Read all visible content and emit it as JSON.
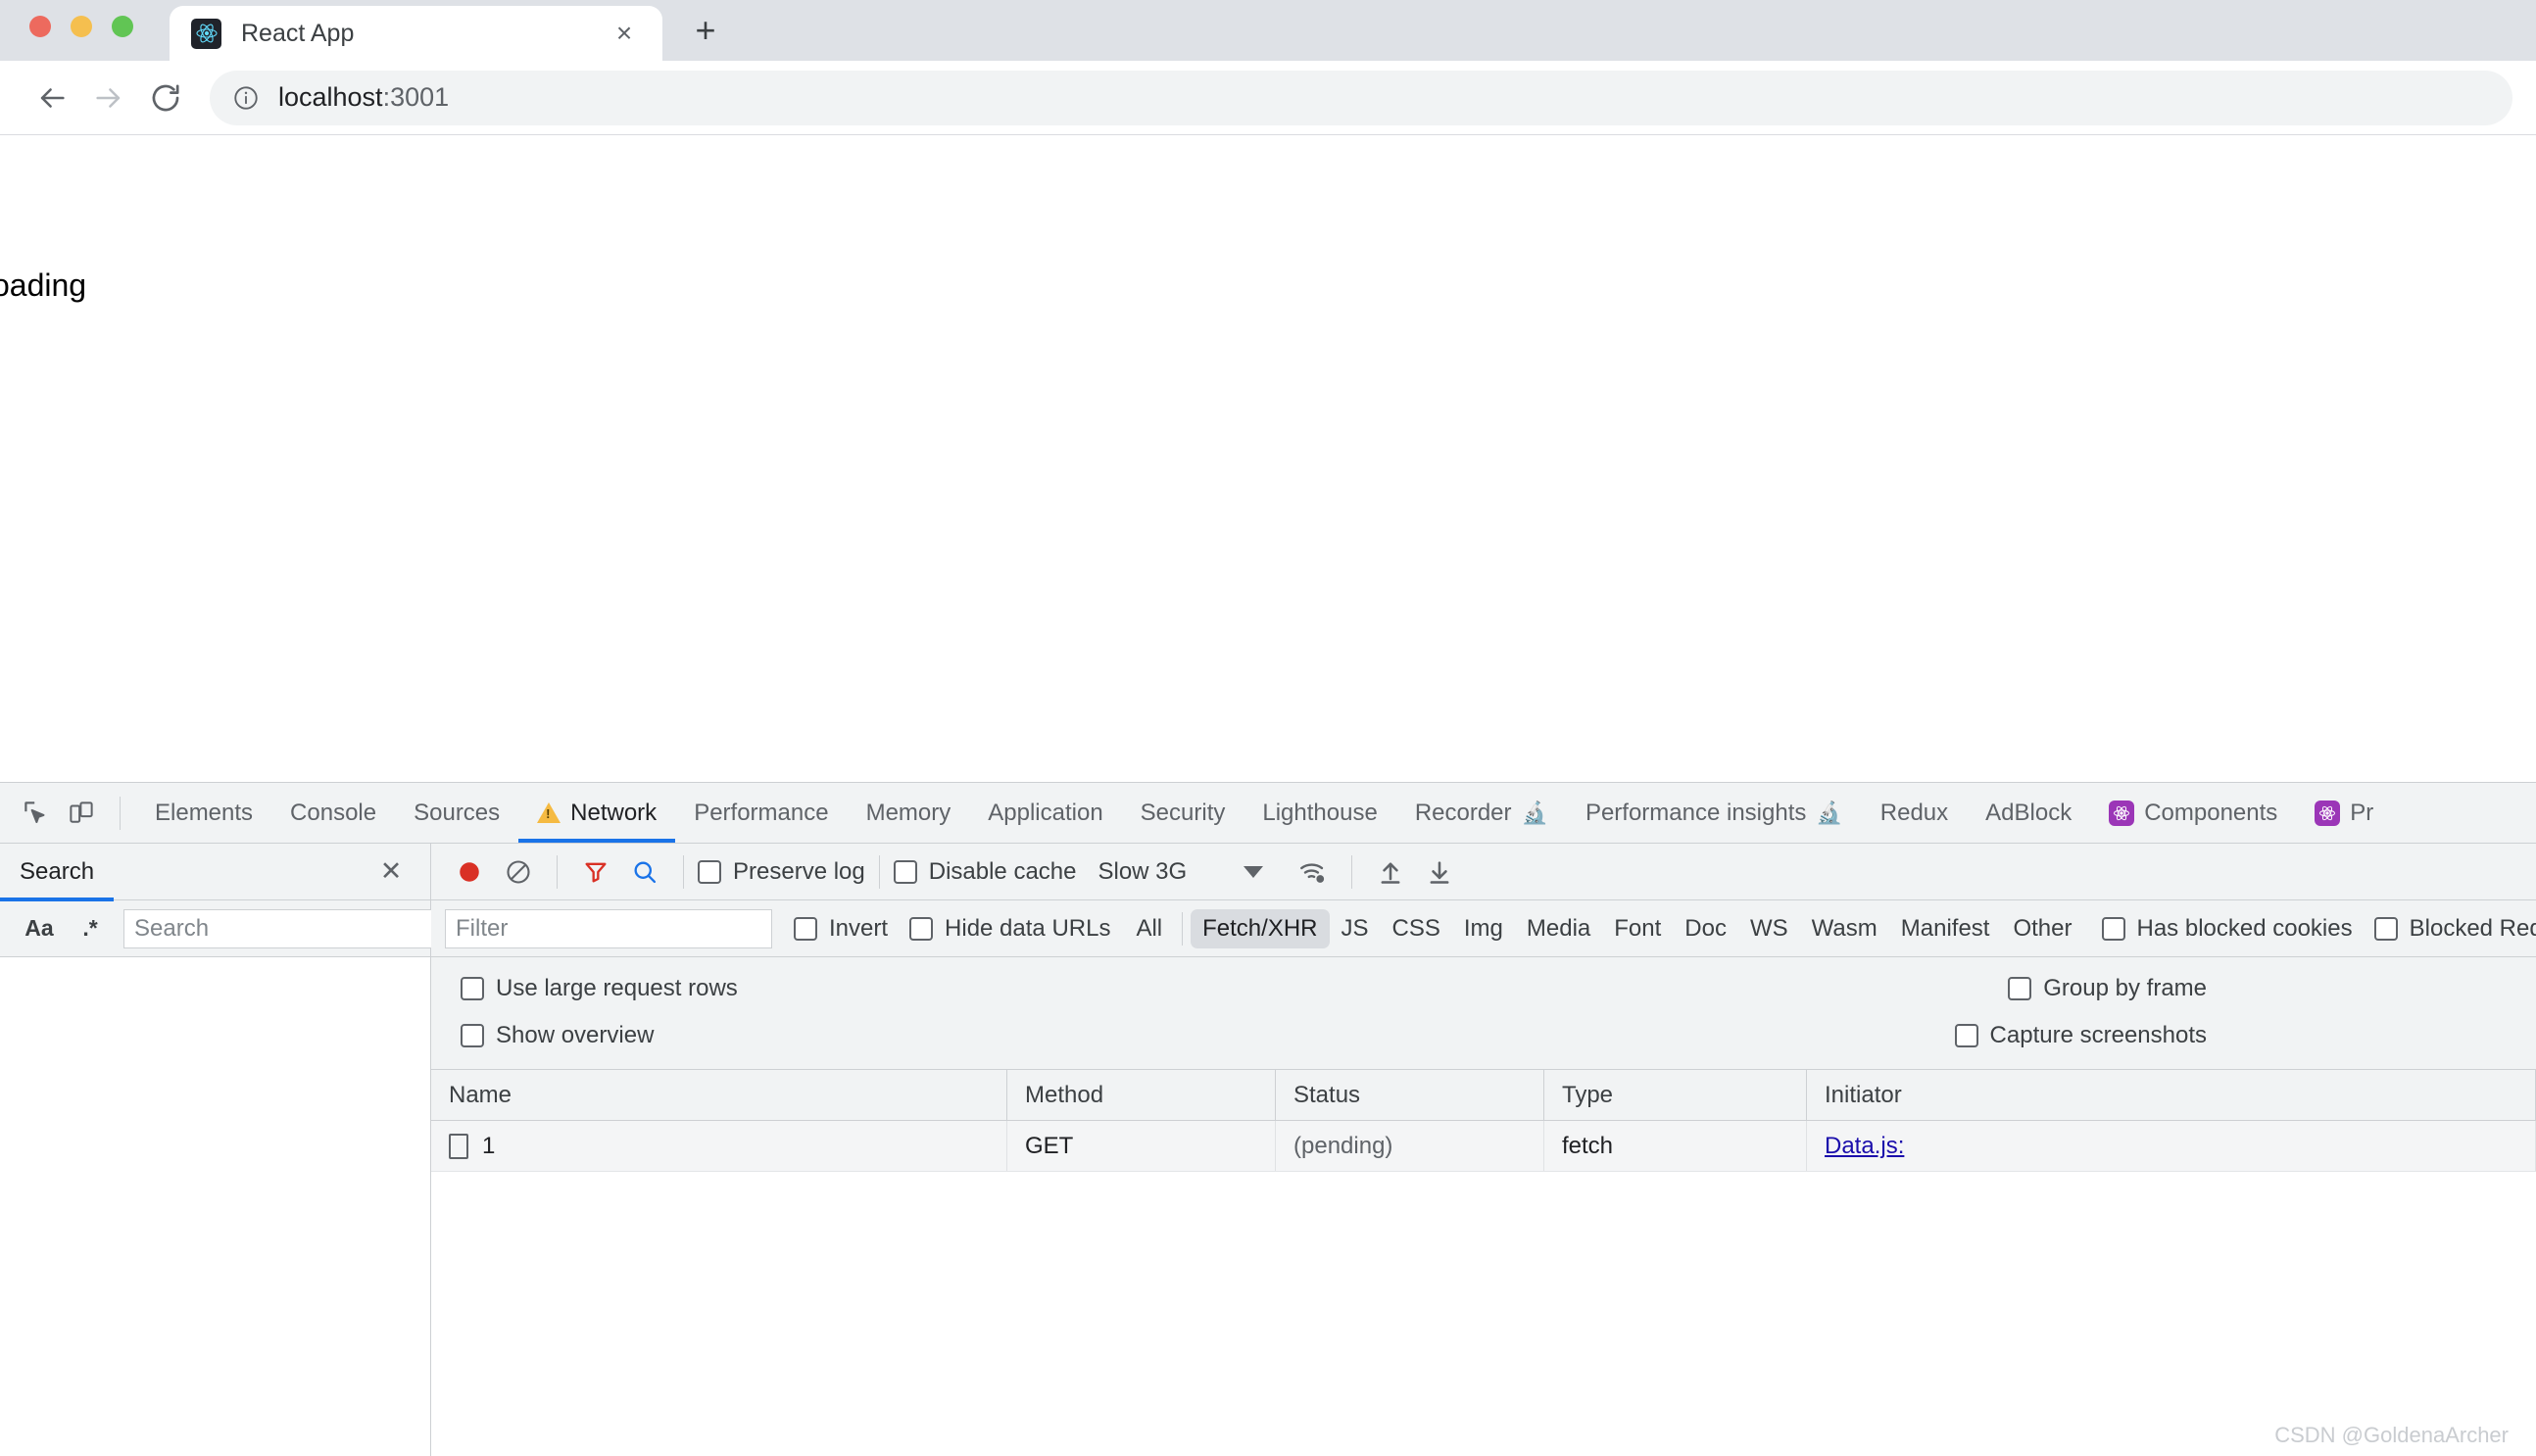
{
  "browser": {
    "window_controls": [
      "close",
      "minimize",
      "maximize"
    ],
    "tab": {
      "title": "React App",
      "favicon": "react-logo-icon",
      "close_label": "×"
    },
    "new_tab_label": "+",
    "nav": {
      "back_label": "←",
      "forward_label": "→",
      "reload_label": "↻"
    },
    "omnibox": {
      "info_icon": "info-circle-icon",
      "host": "localhost",
      "port": ":3001"
    }
  },
  "page": {
    "text": "oading"
  },
  "devtools": {
    "toolbar_icons": [
      "inspect-element-icon",
      "device-toolbar-icon"
    ],
    "tabs": [
      {
        "label": "Elements",
        "active": false,
        "warn": false,
        "flask": false,
        "badge": null
      },
      {
        "label": "Console",
        "active": false,
        "warn": false,
        "flask": false,
        "badge": null
      },
      {
        "label": "Sources",
        "active": false,
        "warn": false,
        "flask": false,
        "badge": null
      },
      {
        "label": "Network",
        "active": true,
        "warn": true,
        "flask": false,
        "badge": null
      },
      {
        "label": "Performance",
        "active": false,
        "warn": false,
        "flask": false,
        "badge": null
      },
      {
        "label": "Memory",
        "active": false,
        "warn": false,
        "flask": false,
        "badge": null
      },
      {
        "label": "Application",
        "active": false,
        "warn": false,
        "flask": false,
        "badge": null
      },
      {
        "label": "Security",
        "active": false,
        "warn": false,
        "flask": false,
        "badge": null
      },
      {
        "label": "Lighthouse",
        "active": false,
        "warn": false,
        "flask": false,
        "badge": null
      },
      {
        "label": "Recorder",
        "active": false,
        "warn": false,
        "flask": true,
        "badge": null
      },
      {
        "label": "Performance insights",
        "active": false,
        "warn": false,
        "flask": true,
        "badge": null
      },
      {
        "label": "Redux",
        "active": false,
        "warn": false,
        "flask": false,
        "badge": null
      },
      {
        "label": "AdBlock",
        "active": false,
        "warn": false,
        "flask": false,
        "badge": null
      },
      {
        "label": "Components",
        "active": false,
        "warn": false,
        "flask": false,
        "badge": "react-badge-icon"
      },
      {
        "label": "Pr",
        "active": false,
        "warn": false,
        "flask": false,
        "badge": "react-badge-icon"
      }
    ],
    "accent_color": "#1a73e8",
    "warning_color": "#f5ba42",
    "react_badge_color": "#9b36b7"
  },
  "search_sidebar": {
    "tab_label": "Search",
    "close_label": "✕",
    "match_case_label": "Aa",
    "regex_label": ".*",
    "input_placeholder": "Search",
    "input_value": "",
    "refresh_icon": "refresh-icon",
    "clear_icon": "clear-icon"
  },
  "network": {
    "toolbar": {
      "record_icon": "record-button-icon",
      "clear_icon": "clear-icon",
      "filter_icon": "filter-funnel-icon",
      "search_icon": "search-icon",
      "preserve_log_label": "Preserve log",
      "preserve_log_checked": false,
      "disable_cache_label": "Disable cache",
      "disable_cache_checked": false,
      "throttle_value": "Slow 3G",
      "throttle_caret": "chevron-down-icon",
      "network_conditions_icon": "wifi-settings-icon",
      "import_har_icon": "upload-arrow-icon",
      "export_har_icon": "download-arrow-icon"
    },
    "filterbar": {
      "filter_placeholder": "Filter",
      "filter_value": "",
      "invert_label": "Invert",
      "invert_checked": false,
      "hide_data_urls_label": "Hide data URLs",
      "hide_data_urls_checked": false,
      "types": [
        {
          "label": "All",
          "selected": false
        },
        {
          "label": "Fetch/XHR",
          "selected": true
        },
        {
          "label": "JS",
          "selected": false
        },
        {
          "label": "CSS",
          "selected": false
        },
        {
          "label": "Img",
          "selected": false
        },
        {
          "label": "Media",
          "selected": false
        },
        {
          "label": "Font",
          "selected": false
        },
        {
          "label": "Doc",
          "selected": false
        },
        {
          "label": "WS",
          "selected": false
        },
        {
          "label": "Wasm",
          "selected": false
        },
        {
          "label": "Manifest",
          "selected": false
        },
        {
          "label": "Other",
          "selected": false
        }
      ],
      "has_blocked_cookies_label": "Has blocked cookies",
      "has_blocked_cookies_checked": false,
      "blocked_requests_label": "Blocked Requests",
      "blocked_requests_checked": false
    },
    "options": {
      "use_large_request_rows_label": "Use large request rows",
      "use_large_request_rows_checked": false,
      "show_overview_label": "Show overview",
      "show_overview_checked": false,
      "group_by_frame_label": "Group by frame",
      "group_by_frame_checked": false,
      "capture_screenshots_label": "Capture screenshots",
      "capture_screenshots_checked": false
    },
    "table": {
      "columns": [
        "Name",
        "Method",
        "Status",
        "Type",
        "Initiator"
      ],
      "rows": [
        {
          "icon": "document-icon",
          "name": "1",
          "method": "GET",
          "status": "(pending)",
          "type": "fetch",
          "initiator": "Data.js:"
        }
      ]
    }
  },
  "watermark": {
    "text": "CSDN @GoldenaArcher"
  }
}
